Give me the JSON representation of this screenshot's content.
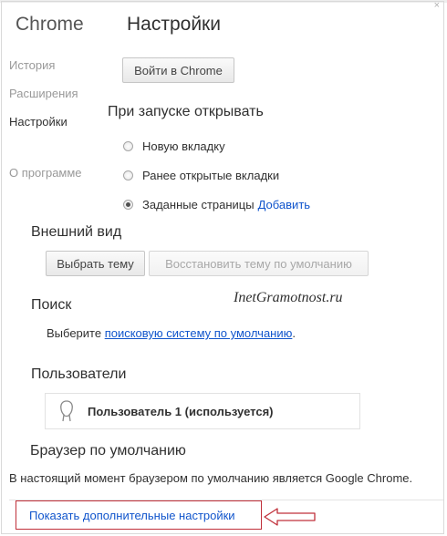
{
  "header": {
    "app_title": "Chrome",
    "page_title": "Настройки"
  },
  "sidebar": {
    "items": [
      {
        "label": "История"
      },
      {
        "label": "Расширения"
      },
      {
        "label": "Настройки"
      },
      {
        "label": "О программе"
      }
    ]
  },
  "signin": {
    "button_label": "Войти в Chrome"
  },
  "startup": {
    "title": "При запуске открывать",
    "options": [
      {
        "label": "Новую вкладку",
        "checked": false
      },
      {
        "label": "Ранее открытые вкладки",
        "checked": false
      },
      {
        "label": "Заданные страницы",
        "checked": true
      }
    ],
    "add_link": "Добавить"
  },
  "appearance": {
    "title": "Внешний вид",
    "choose_theme": "Выбрать тему",
    "reset_theme": "Восстановить тему по умолчанию"
  },
  "watermark": "InetGramotnost.ru",
  "search": {
    "title": "Поиск",
    "text_before": "Выберите ",
    "link": "поисковую систему по умолчанию",
    "text_after": "."
  },
  "users": {
    "title": "Пользователи",
    "current_user": "Пользователь 1 (используется)"
  },
  "default_browser": {
    "title": "Браузер по умолчанию",
    "status": "В настоящий момент браузером по умолчанию является Google Chrome."
  },
  "advanced": {
    "link": "Показать дополнительные настройки"
  },
  "colors": {
    "link": "#1155cc",
    "highlight_border": "#c0303a",
    "arrow": "#c0303a"
  }
}
